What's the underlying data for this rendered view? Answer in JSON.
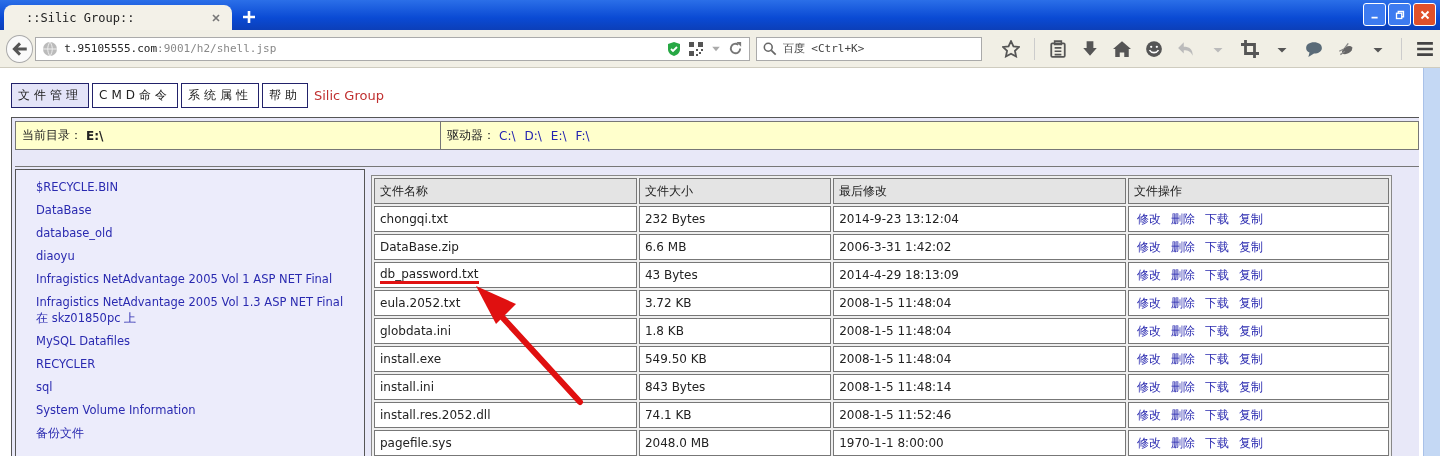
{
  "browser": {
    "tab_title": "::Silic Group::",
    "url_host": "t.95105555.com",
    "url_path": ":9001/h2/shell.jsp",
    "search_placeholder": "百度 <Ctrl+K>"
  },
  "nav_tabs": [
    {
      "label": "文件管理",
      "selected": true
    },
    {
      "label": "CMD命令",
      "selected": false
    },
    {
      "label": "系统属性",
      "selected": false
    },
    {
      "label": "帮助",
      "selected": false
    }
  ],
  "brand": "Silic Group",
  "current_dir": {
    "label": "当前目录：",
    "value": "E:\\"
  },
  "drives": {
    "label": "驱动器：",
    "items": [
      "C:\\",
      "D:\\",
      "E:\\",
      "F:\\"
    ]
  },
  "folders": [
    "$RECYCLE.BIN",
    "DataBase",
    "database_old",
    "diaoyu",
    "Infragistics NetAdvantage 2005 Vol 1 ASP NET Final",
    "Infragistics NetAdvantage 2005 Vol 1.3 ASP NET Final 在 skz01850pc 上",
    "MySQL Datafiles",
    "RECYCLER",
    "sql",
    "System Volume Information",
    "备份文件"
  ],
  "table": {
    "columns": [
      "文件名称",
      "文件大小",
      "最后修改",
      "文件操作"
    ],
    "rows": [
      {
        "name": "chongqi.txt",
        "size": "232 Bytes",
        "modified": "2014-9-23 13:12:04",
        "actions": [
          "修改",
          "删除",
          "下载",
          "复制"
        ],
        "highlighted": false
      },
      {
        "name": "DataBase.zip",
        "size": "6.6 MB",
        "modified": "2006-3-31 1:42:02",
        "actions": [
          "修改",
          "删除",
          "下载",
          "复制"
        ],
        "highlighted": false
      },
      {
        "name": "db_password.txt",
        "size": "43 Bytes",
        "modified": "2014-4-29 18:13:09",
        "actions": [
          "修改",
          "删除",
          "下载",
          "复制"
        ],
        "highlighted": true
      },
      {
        "name": "eula.2052.txt",
        "size": "3.72 KB",
        "modified": "2008-1-5 11:48:04",
        "actions": [
          "修改",
          "删除",
          "下载",
          "复制"
        ],
        "highlighted": false
      },
      {
        "name": "globdata.ini",
        "size": "1.8 KB",
        "modified": "2008-1-5 11:48:04",
        "actions": [
          "修改",
          "删除",
          "下载",
          "复制"
        ],
        "highlighted": false
      },
      {
        "name": "install.exe",
        "size": "549.50 KB",
        "modified": "2008-1-5 11:48:04",
        "actions": [
          "修改",
          "删除",
          "下载",
          "复制"
        ],
        "highlighted": false
      },
      {
        "name": "install.ini",
        "size": "843 Bytes",
        "modified": "2008-1-5 11:48:14",
        "actions": [
          "修改",
          "删除",
          "下载",
          "复制"
        ],
        "highlighted": false
      },
      {
        "name": "install.res.2052.dll",
        "size": "74.1 KB",
        "modified": "2008-1-5 11:52:46",
        "actions": [
          "修改",
          "删除",
          "下载",
          "复制"
        ],
        "highlighted": false
      },
      {
        "name": "pagefile.sys",
        "size": "2048.0 MB",
        "modified": "1970-1-1 8:00:00",
        "actions": [
          "修改",
          "删除",
          "下载",
          "复制"
        ],
        "highlighted": false
      }
    ]
  }
}
